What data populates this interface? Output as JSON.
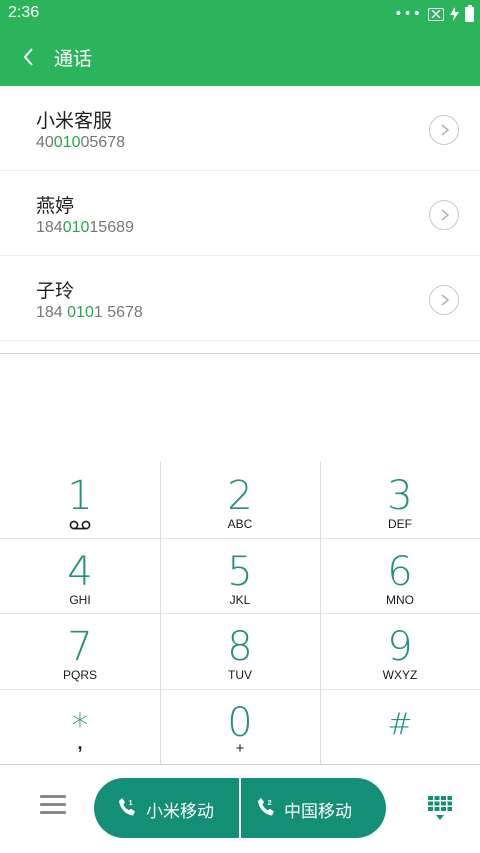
{
  "status_bar": {
    "time": "2:36"
  },
  "app_bar": {
    "title": "通话"
  },
  "contacts": [
    {
      "name": "小米客服",
      "number_pre": "40",
      "number_match": "010",
      "number_post": "05678"
    },
    {
      "name": "燕婷",
      "number_pre": "184",
      "number_match": "010",
      "number_post": "15689"
    },
    {
      "name": "子玲",
      "number_pre": "184 ",
      "number_match": "010",
      "number_post": "1 5678"
    }
  ],
  "keypad": {
    "keys": [
      {
        "digit": "1",
        "letters": ""
      },
      {
        "digit": "2",
        "letters": "ABC"
      },
      {
        "digit": "3",
        "letters": "DEF"
      },
      {
        "digit": "4",
        "letters": "GHI"
      },
      {
        "digit": "5",
        "letters": "JKL"
      },
      {
        "digit": "6",
        "letters": "MNO"
      },
      {
        "digit": "7",
        "letters": "PQRS"
      },
      {
        "digit": "8",
        "letters": "TUV"
      },
      {
        "digit": "9",
        "letters": "WXYZ"
      },
      {
        "digit": "*",
        "letters": ","
      },
      {
        "digit": "0",
        "letters": "+"
      },
      {
        "digit": "#",
        "letters": ""
      }
    ]
  },
  "call_buttons": {
    "sim1_label": "小米移动",
    "sim2_label": "中国移动"
  },
  "icons": {
    "back": "chevron-left-icon",
    "voicemail": "voicemail-icon",
    "menu": "hamburger-menu-icon",
    "dialpad": "dialpad-icon",
    "call": "phone-icon",
    "detail": "chevron-right-circle-icon"
  },
  "colors": {
    "app_bar": "#2cb45d",
    "accent": "#22907a",
    "call_button": "#138f75",
    "match_highlight": "#27a64f"
  }
}
